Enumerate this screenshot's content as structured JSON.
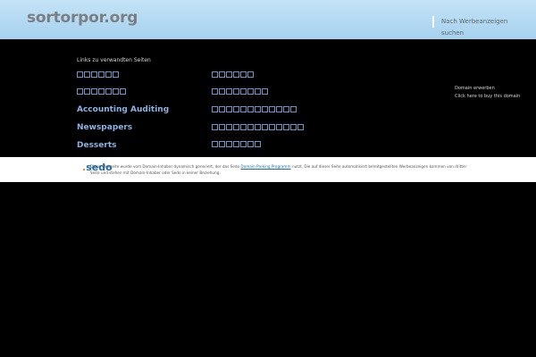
{
  "header": {
    "title": "sortorpor.org",
    "search_link": "Nach Werbeanzeigen suchen"
  },
  "main": {
    "heading": "Links zu verwandten Seiten",
    "left_links": [
      {
        "label": "",
        "box_count": 6
      },
      {
        "label": "",
        "box_count": 7
      },
      {
        "label": "Accounting Auditing",
        "box_count": 0
      },
      {
        "label": "Newspapers",
        "box_count": 0
      },
      {
        "label": "Desserts",
        "box_count": 0
      }
    ],
    "right_links": [
      {
        "box_count": 6
      },
      {
        "box_count": 8
      },
      {
        "box_count": 12
      },
      {
        "box_count": 13
      },
      {
        "box_count": 7
      }
    ]
  },
  "side": {
    "domain_label": "Domain erwerben",
    "domain_text": "Click here to buy this domain"
  },
  "footer": {
    "logo_text": "sedo",
    "disclaimer_before": "Diese Webseite wurde vom Domain-Inhaber dynamisch generiert, der das Sedo",
    "disclaimer_link": "Domain Parking Programm",
    "disclaimer_after": "nutzt. Die auf dieser Seite automatisiert bereitgestellten Werbeanzeigen kommen von dritter Seite und stehen mit Domain-Inhaber oder Sedo in keiner Beziehung."
  },
  "colors": {
    "header_top": "#c4e3f6",
    "header_bottom": "#a6d1ee",
    "link": "#8ab2e4",
    "sedo_blue": "#1a6aab"
  }
}
